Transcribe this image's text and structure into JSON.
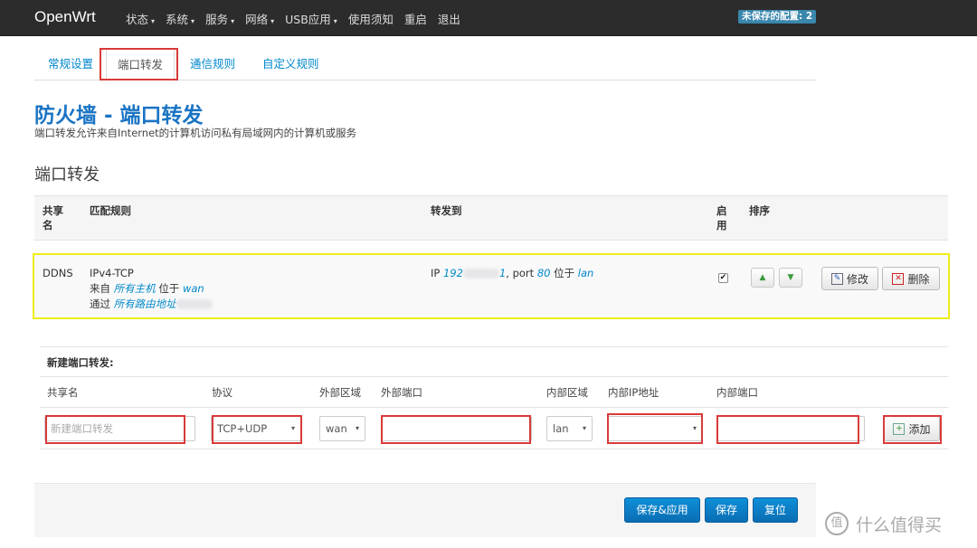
{
  "navbar": {
    "brand": "OpenWrt",
    "items": [
      {
        "label": "状态",
        "dropdown": true
      },
      {
        "label": "系统",
        "dropdown": true
      },
      {
        "label": "服务",
        "dropdown": true
      },
      {
        "label": "网络",
        "dropdown": true
      },
      {
        "label": "USB应用",
        "dropdown": true
      },
      {
        "label": "使用须知",
        "dropdown": false
      },
      {
        "label": "重启",
        "dropdown": false
      },
      {
        "label": "退出",
        "dropdown": false
      }
    ],
    "caret": "▾",
    "unsaved_badge": "未保存的配置: 2"
  },
  "tabs": [
    "常规设置",
    "端口转发",
    "通信规则",
    "自定义规则"
  ],
  "page": {
    "title": "防火墙 - 端口转发",
    "description": "端口转发允许来自Internet的计算机访问私有局域网内的计算机或服务",
    "section_title": "端口转发"
  },
  "table": {
    "headers": {
      "name_l1": "共享",
      "name_l2": "名",
      "match": "匹配规则",
      "forward": "转发到",
      "enable_l1": "启",
      "enable_l2": "用",
      "sort": "排序"
    },
    "rows": [
      {
        "name": "DDNS",
        "proto": "IPv4-TCP",
        "from_prefix": "来自",
        "from_value": "所有主机",
        "from_zone_prefix": "位于",
        "from_zone": "wan",
        "via_prefix": "通过",
        "via_value": "所有路由地址",
        "fw_ip_prefix": "IP",
        "fw_ip_start": "192",
        "fw_ip_end": "1",
        "fw_port_prefix": ", port",
        "fw_port": "80",
        "fw_zone_prefix": "位于",
        "fw_zone": "lan",
        "enabled": true,
        "edit_label": "修改",
        "delete_label": "删除"
      }
    ]
  },
  "new_forward": {
    "title": "新建端口转发:",
    "labels": {
      "name": "共享名",
      "protocol": "协议",
      "ext_zone": "外部区域",
      "ext_port": "外部端口",
      "int_zone": "内部区域",
      "int_ip": "内部IP地址",
      "int_port": "内部端口"
    },
    "name_placeholder": "新建端口转发",
    "protocol_value": "TCP+UDP",
    "ext_zone_value": "wan",
    "ext_port_value": "",
    "int_zone_value": "lan",
    "int_ip_value": "",
    "int_port_value": "",
    "add_label": "添加"
  },
  "footer": {
    "save_apply": "保存&应用",
    "save": "保存",
    "reset": "复位"
  },
  "watermark": {
    "logo_text": "值",
    "text": "什么值得买"
  },
  "colors": {
    "navbar": "#2c2c2c",
    "accent": "#0088cc",
    "highlight_border": "#f0ec18",
    "annotation_red": "#d93a3a",
    "primary_button": "#0a6db3"
  }
}
